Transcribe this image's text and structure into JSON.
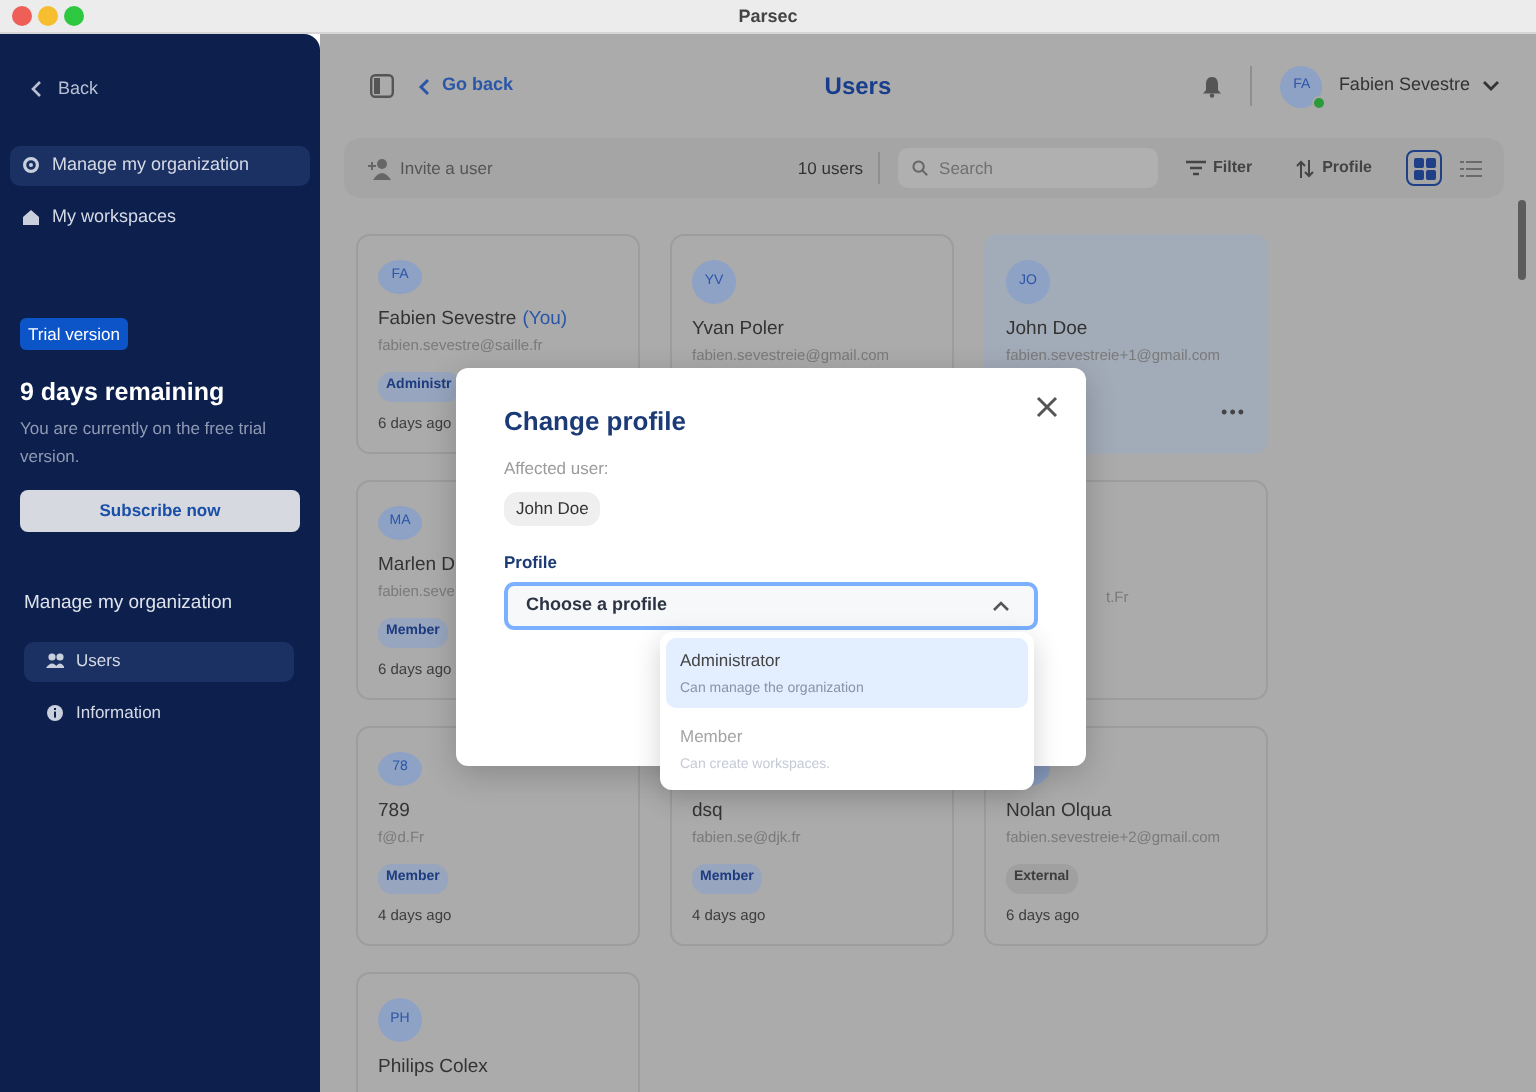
{
  "window": {
    "title": "Parsec"
  },
  "sidebar": {
    "back": "Back",
    "nav": [
      {
        "kind": "organization",
        "label": "Manage my organization",
        "selected": true
      },
      {
        "kind": "workspaces",
        "label": "My workspaces",
        "selected": false
      }
    ],
    "trial": {
      "badge": "Trial version",
      "remaining": "9 days remaining",
      "description": "You are currently on the free trial version.",
      "button": "Subscribe now"
    },
    "section_title": "Manage my organization",
    "menu": [
      {
        "kind": "users",
        "label": "Users",
        "selected": true
      },
      {
        "kind": "information",
        "label": "Information",
        "selected": false
      }
    ]
  },
  "header": {
    "back": "Go back",
    "title": "Users",
    "user": {
      "initials": "FA",
      "name": "Fabien Sevestre",
      "online": true
    }
  },
  "toolbar": {
    "invite": "Invite a user",
    "count": "10 users",
    "search": {
      "placeholder": "Search"
    },
    "filter": "Filter",
    "sort": "Profile",
    "views": [
      {
        "kind": "grid",
        "selected": true
      },
      {
        "kind": "list",
        "selected": false
      }
    ]
  },
  "cards": [
    {
      "avatar": true,
      "initials": "FA",
      "name": "Fabien Sevestre",
      "suffix": "(You)",
      "email": "fabien.sevestre@saille.fr",
      "role": {
        "label": "Administr",
        "kind": "admin"
      },
      "time": "6 days ago",
      "selected": false
    },
    {
      "avatar": true,
      "initials": "YV",
      "name": "Yvan Poler",
      "email": "fabien.sevestreie@gmail.com",
      "selected": false
    },
    {
      "avatar": true,
      "initials": "JO",
      "name": "John Doe",
      "email": "fabien.sevestreie+1@gmail.com",
      "menu": "•••",
      "selected": true
    },
    {
      "avatar": true,
      "initials": "MA",
      "name": "Marlen D",
      "email": "fabien.seve",
      "role": {
        "label": "Member",
        "kind": "member"
      },
      "time": "6 days ago",
      "selected": false
    },
    {
      "kind": "hidden"
    },
    {
      "kind": "covered",
      "email": "t.Fr",
      "selected": false
    },
    {
      "avatar": true,
      "initials": "78",
      "name": "789",
      "email": "f@d.Fr",
      "role": {
        "label": "Member",
        "kind": "member"
      },
      "time": "4 days ago",
      "selected": false
    },
    {
      "avatar": false,
      "name": "dsq",
      "email": "fabien.se@djk.fr",
      "role": {
        "label": "Member",
        "kind": "member"
      },
      "time": "4 days ago",
      "selected": false
    },
    {
      "avatar": true,
      "name": "Nolan Olqua",
      "email": "fabien.sevestreie+2@gmail.com",
      "role": {
        "label": "External",
        "kind": "external"
      },
      "time": "6 days ago",
      "selected": false
    },
    {
      "avatar": true,
      "initials": "PH",
      "name": "Philips Colex",
      "selected": false
    }
  ],
  "modal": {
    "title": "Change profile",
    "affected_label": "Affected user:",
    "affected_user": "John Doe",
    "field_label": "Profile",
    "select": {
      "text": "Choose a profile",
      "expanded": true
    },
    "options": [
      {
        "label": "Administrator",
        "description": "Can manage the organization",
        "selected": true,
        "disabled": false
      },
      {
        "label": "Member",
        "description": "Can create workspaces.",
        "selected": false,
        "disabled": true
      }
    ]
  }
}
